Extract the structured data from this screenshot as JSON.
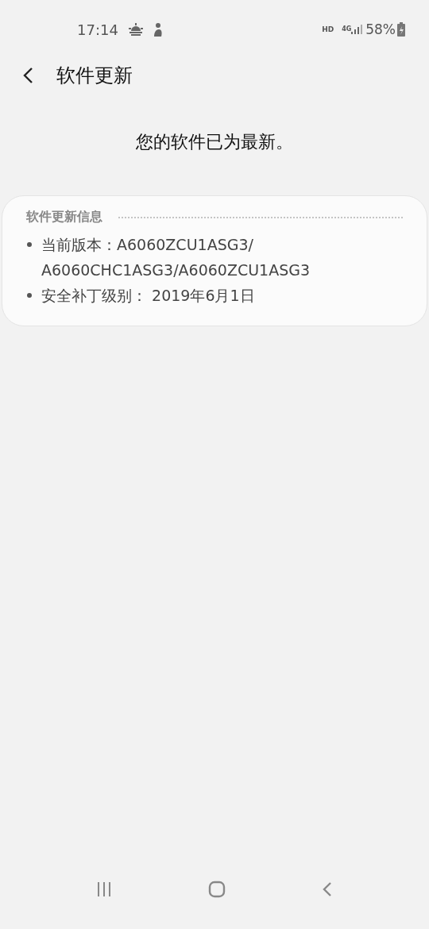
{
  "status_bar": {
    "time": "17:14",
    "network_type": "HD",
    "mobile_data": "4G",
    "battery": "58%"
  },
  "header": {
    "title": "软件更新"
  },
  "message": "您的软件已为最新。",
  "info_card": {
    "title": "软件更新信息",
    "items": [
      "当前版本：A6060ZCU1ASG3/A6060CHC1ASG3/A6060ZCU1ASG3",
      "安全补丁级别： 2019年6月1日"
    ]
  }
}
